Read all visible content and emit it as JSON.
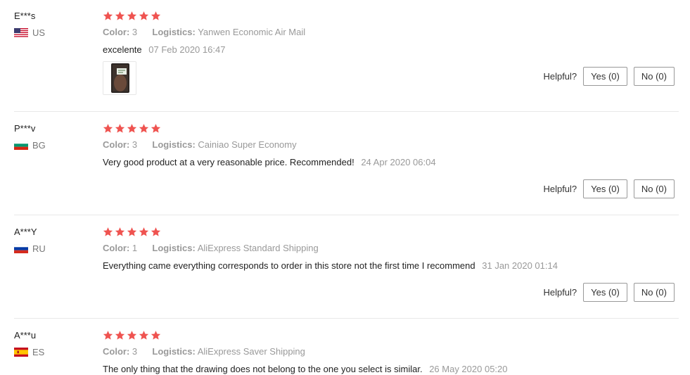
{
  "colors": {
    "star": "#ef5350",
    "label": "#999999",
    "separator": "#e8e8e8"
  },
  "reviews": [
    {
      "user": "E***s",
      "country": "US",
      "flag": "us-flag",
      "stars": 5,
      "color_label": "Color:",
      "color_value": "3",
      "logistics_label": "Logistics:",
      "logistics_value": "Yanwen Economic Air Mail",
      "text": "excelente",
      "date": "07 Feb 2020 16:47",
      "has_photo": true,
      "helpful_label": "Helpful?",
      "yes_label": "Yes (0)",
      "no_label": "No (0)"
    },
    {
      "user": "P***v",
      "country": "BG",
      "flag": "bg-flag",
      "stars": 5,
      "color_label": "Color:",
      "color_value": "3",
      "logistics_label": "Logistics:",
      "logistics_value": "Cainiao Super Economy",
      "text": "Very good product at a very reasonable price. Recommended!",
      "date": "24 Apr 2020 06:04",
      "has_photo": false,
      "helpful_label": "Helpful?",
      "yes_label": "Yes (0)",
      "no_label": "No (0)"
    },
    {
      "user": "A***Y",
      "country": "RU",
      "flag": "ru-flag",
      "stars": 5,
      "color_label": "Color:",
      "color_value": "1",
      "logistics_label": "Logistics:",
      "logistics_value": "AliExpress Standard Shipping",
      "text": "Everything came everything corresponds to order in this store not the first time I recommend",
      "date": "31 Jan 2020 01:14",
      "has_photo": false,
      "helpful_label": "Helpful?",
      "yes_label": "Yes (0)",
      "no_label": "No (0)"
    },
    {
      "user": "A***u",
      "country": "ES",
      "flag": "es-flag",
      "stars": 5,
      "color_label": "Color:",
      "color_value": "3",
      "logistics_label": "Logistics:",
      "logistics_value": "AliExpress Saver Shipping",
      "text": "The only thing that the drawing does not belong to the one you select is similar.",
      "date": "26 May 2020 05:20",
      "has_photo": false
    }
  ]
}
